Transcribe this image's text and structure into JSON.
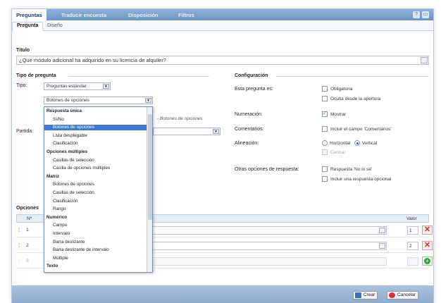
{
  "tabs": [
    "Preguntas",
    "Traducir encuesta",
    "Disposición",
    "Filtros"
  ],
  "subtabs": [
    "Pregunta",
    "Diseño"
  ],
  "titulo": {
    "label": "Título",
    "value": "¿Qué módulo adicional ha adquirido en su licencia de alquiler?"
  },
  "tipo": {
    "section": "Tipo de pregunta",
    "tipo_label": "Tipo:",
    "tipo_value": "Preguntas estándar",
    "subtipo_value": "Botones de opciones",
    "hint": "- Botones de opciones",
    "partida_label": "Partida:"
  },
  "dropdown": [
    {
      "text": "Respuesta única",
      "group": true
    },
    {
      "text": "Sí/No"
    },
    {
      "text": "Botones de opciones",
      "selected": true
    },
    {
      "text": "Lista desplegable"
    },
    {
      "text": "Clasificación"
    },
    {
      "text": "Opciones múltiples",
      "group": true
    },
    {
      "text": "Casillas de selección"
    },
    {
      "text": "Casilla de opciones múltiples"
    },
    {
      "text": "Matriz",
      "group": true
    },
    {
      "text": "Botones de opciones"
    },
    {
      "text": "Casillas de selección"
    },
    {
      "text": "Clasificación"
    },
    {
      "text": "Rango"
    },
    {
      "text": "Numérico",
      "group": true
    },
    {
      "text": "Campo"
    },
    {
      "text": "Intervalo"
    },
    {
      "text": "Barra deslizante"
    },
    {
      "text": "Barra deslizante de intervalo"
    },
    {
      "text": "Múltiple"
    },
    {
      "text": "Texto",
      "group": true
    }
  ],
  "config": {
    "section": "Configuración",
    "esta_label": "Esta pregunta es:",
    "obligatoria": "Obligatoria",
    "oculta": "Oculta desde la apertura",
    "numeracion_label": "Numeración:",
    "mostrar": "Mostrar",
    "comentarios_label": "Comentarios:",
    "incluir_comentarios": "Incluir el campo 'Comentarios'",
    "alineacion_label": "Alineación:",
    "horizontal": "Horizontal",
    "vertical": "Vertical",
    "centrar": "Centrar",
    "otras_label": "Otras opciones de respuesta:",
    "no_se": "Respuesta 'No lo sé'",
    "opcional": "Incluir una respuesta opcional"
  },
  "opciones": {
    "section": "Opciones",
    "col_n": "Nº",
    "col_valor": "Valor",
    "rows": [
      {
        "n": "1",
        "valor": "1"
      },
      {
        "n": "2",
        "valor": "2"
      },
      {
        "n": "3",
        "valor": ""
      }
    ]
  },
  "footer": {
    "save": "Crear",
    "cancel": "Cancelar"
  }
}
